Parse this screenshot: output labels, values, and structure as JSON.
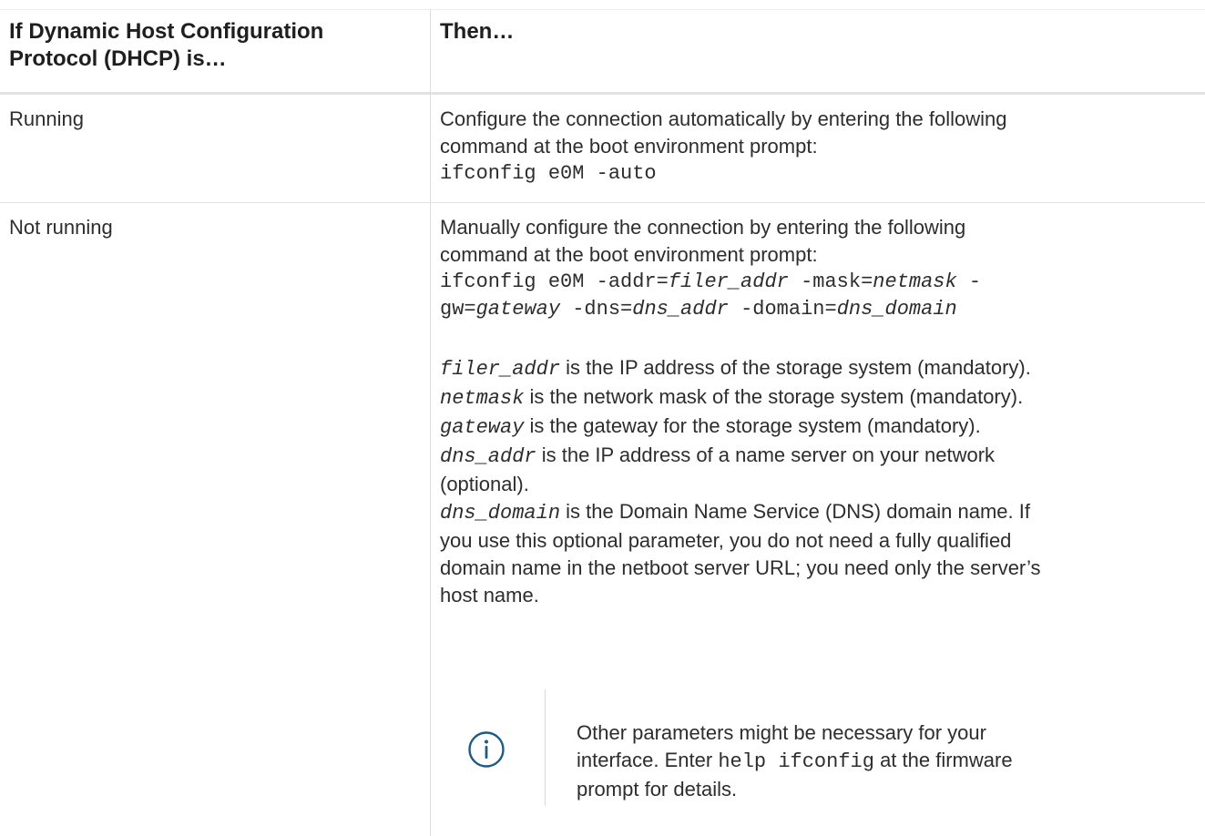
{
  "table": {
    "header": {
      "col1": "If Dynamic Host Configuration Protocol (DHCP) is…",
      "col1_line1": "If Dynamic Host Configuration",
      "col1_line2": "Protocol (DHCP) is…",
      "col2": "Then…"
    },
    "rows": [
      {
        "condition": "Running",
        "action_line1": "Configure the connection automatically by entering the following",
        "action_line2": "command at the boot environment prompt:",
        "command": "ifconfig e0M -auto"
      },
      {
        "condition": "Not running",
        "action_line1": "Manually configure the connection by entering the following",
        "action_line2": "command at the boot environment prompt:",
        "command_line1": {
          "p1": "ifconfig e0M -addr=",
          "p2": "filer_addr",
          "p3": " -mask=",
          "p4": "netmask",
          "p5": " -"
        },
        "command_line2": {
          "p1": "gw=",
          "p2": "gateway",
          "p3": " -dns=",
          "p4": "dns_addr",
          "p5": " -domain=",
          "p6": "dns_domain"
        },
        "params": [
          {
            "name": "filer_addr",
            "desc": " is the IP address of the storage system (mandatory)."
          },
          {
            "name": "netmask",
            "desc": " is the network mask of the storage system (mandatory)."
          },
          {
            "name": "gateway",
            "desc": " is the gateway for the storage system (mandatory)."
          },
          {
            "name": "dns_addr",
            "desc": " is the IP address of a name server on your network"
          }
        ],
        "optional_line": "(optional).",
        "dns_domain": {
          "name": "dns_domain",
          "desc_line1": " is the Domain Name Service (DNS) domain name. If",
          "desc_line2": "you use this optional parameter, you do not need a fully qualified",
          "desc_line3": "domain name in the netboot server URL; you need only the server’s",
          "desc_line4": "host name."
        },
        "note": {
          "icon": "info-icon",
          "line1": "Other parameters might be necessary for your",
          "line2_a": "interface. Enter ",
          "line2_code": "help ifconfig",
          "line2_b": " at the firmware",
          "line3": "prompt for details."
        }
      }
    ]
  },
  "colors": {
    "text": "#2d2d2d",
    "header_text": "#1f1f1f",
    "border": "#dcdcdc",
    "header_border": "#e2e2e2",
    "icon": "#1d5a88"
  }
}
